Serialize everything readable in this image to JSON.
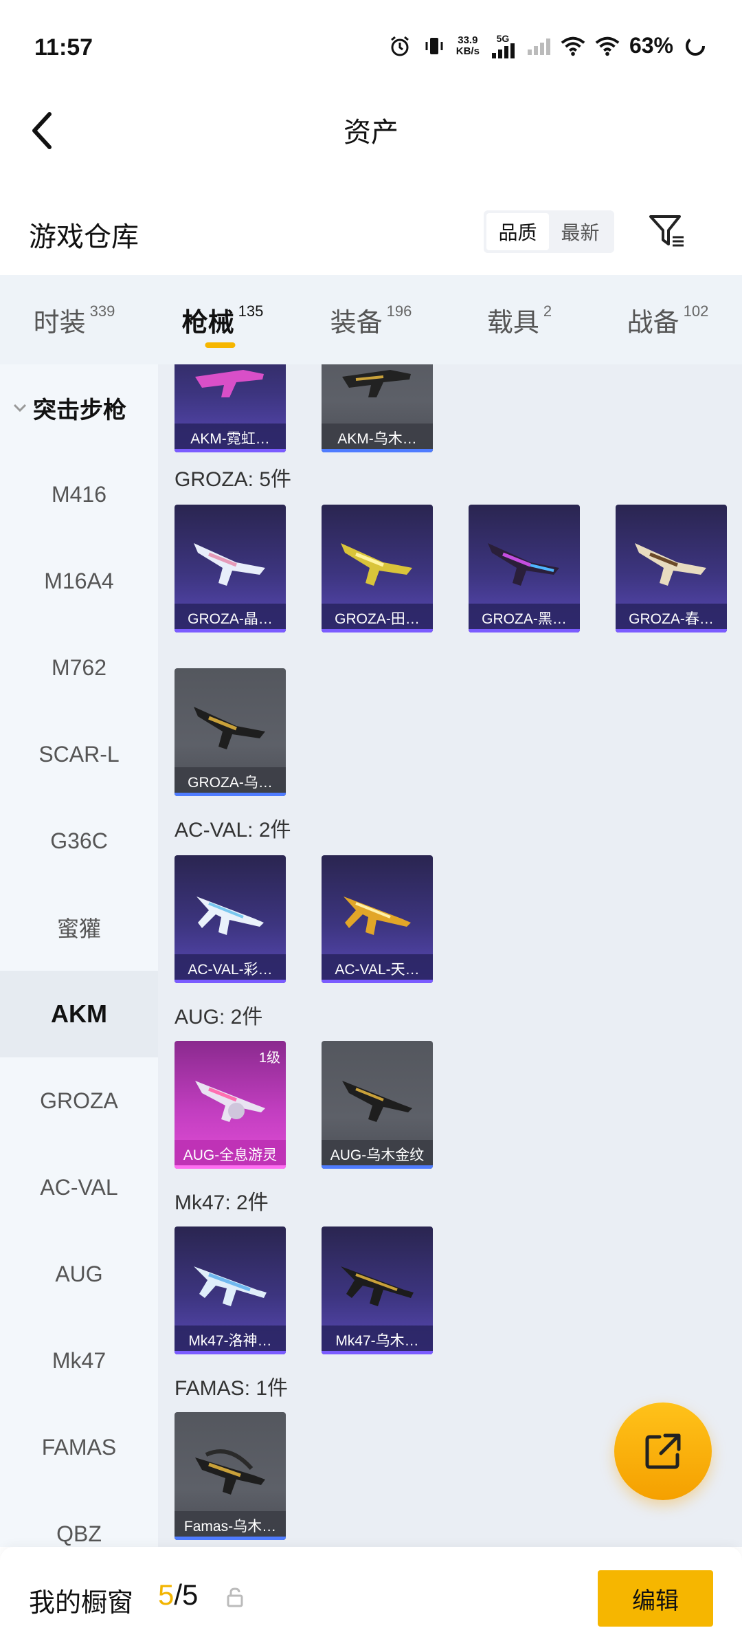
{
  "status_bar": {
    "time": "11:57",
    "net_speed_top": "33.9",
    "net_speed_bottom": "KB/s",
    "network": "5G",
    "battery": "63%"
  },
  "header": {
    "title": "资产"
  },
  "warehouse": {
    "title": "游戏仓库",
    "sort_options": [
      "品质",
      "最新"
    ],
    "sort_selected": "品质"
  },
  "tabs": [
    {
      "label": "时装",
      "count": "339"
    },
    {
      "label": "枪械",
      "count": "135"
    },
    {
      "label": "装备",
      "count": "196"
    },
    {
      "label": "载具",
      "count": "2"
    },
    {
      "label": "战备",
      "count": "102"
    }
  ],
  "active_tab": "枪械",
  "sidebar": {
    "category": "突击步枪",
    "items": [
      "M416",
      "M16A4",
      "M762",
      "SCAR-L",
      "G36C",
      "蜜獾",
      "AKM",
      "GROZA",
      "AC-VAL",
      "AUG",
      "Mk47",
      "FAMAS",
      "QBZ"
    ],
    "active": "AKM"
  },
  "groups": [
    {
      "title": "",
      "items": [
        {
          "name": "AKM-霓虹…",
          "rarity": "purple"
        },
        {
          "name": "AKM-乌木…",
          "rarity": "gray"
        }
      ]
    },
    {
      "title": "GROZA: 5件",
      "items": [
        {
          "name": "GROZA-晶…",
          "rarity": "purple"
        },
        {
          "name": "GROZA-田…",
          "rarity": "purple"
        },
        {
          "name": "GROZA-黑…",
          "rarity": "purple"
        },
        {
          "name": "GROZA-春…",
          "rarity": "purple"
        },
        {
          "name": "GROZA-乌…",
          "rarity": "gray"
        }
      ]
    },
    {
      "title": "AC-VAL: 2件",
      "items": [
        {
          "name": "AC-VAL-彩…",
          "rarity": "purple"
        },
        {
          "name": "AC-VAL-天…",
          "rarity": "purple"
        }
      ]
    },
    {
      "title": "AUG: 2件",
      "items": [
        {
          "name": "AUG-全息游灵",
          "rarity": "pink",
          "level": "1级"
        },
        {
          "name": "AUG-乌木金纹",
          "rarity": "gray"
        }
      ]
    },
    {
      "title": "Mk47: 2件",
      "items": [
        {
          "name": "Mk47-洛神…",
          "rarity": "purple"
        },
        {
          "name": "Mk47-乌木…",
          "rarity": "purple"
        }
      ]
    },
    {
      "title": "FAMAS: 1件",
      "items": [
        {
          "name": "Famas-乌木…",
          "rarity": "gray"
        }
      ]
    }
  ],
  "bottom_bar": {
    "label": "我的橱窗",
    "current": "5",
    "separator": "/",
    "total": "5",
    "edit_label": "编辑"
  },
  "colors": {
    "accent": "#f6b600",
    "purple_card": "#3d3580",
    "gray_card": "#5d6068",
    "pink_card": "#c23ec0"
  }
}
